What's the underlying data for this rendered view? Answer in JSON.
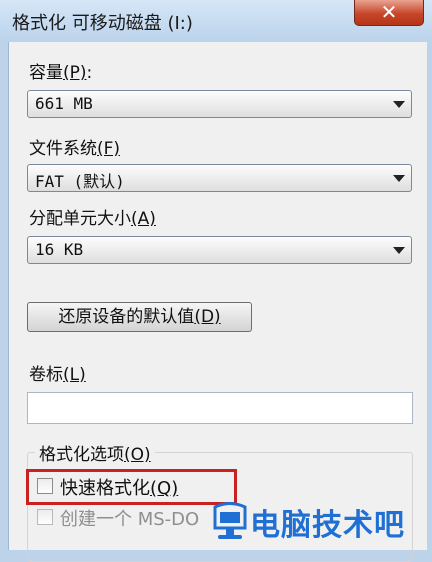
{
  "window": {
    "title": "格式化 可移动磁盘 (I:)",
    "close_glyph": "✕"
  },
  "capacity": {
    "label_prefix": "容量",
    "label_access": "(P)",
    "label_suffix": ":",
    "value": "661 MB"
  },
  "filesystem": {
    "label_prefix": "文件系统",
    "label_access": "(F)",
    "value": "FAT (默认)"
  },
  "allocation": {
    "label_prefix": "分配单元大小",
    "label_access": "(A)",
    "value": "16 KB"
  },
  "restore_defaults": {
    "label": "还原设备的默认值",
    "access": "(D)"
  },
  "volume_label": {
    "label_prefix": "卷标",
    "label_access": "(L)",
    "value": ""
  },
  "format_options": {
    "title": "格式化选项",
    "title_access": "(O)",
    "quick_format": {
      "label": "快速格式化",
      "access": "(Q)",
      "checked": false
    },
    "msdos_disk": {
      "label": "创建一个 MS-DO",
      "access": "",
      "checked": false,
      "disabled": true
    }
  },
  "highlight_color": "#c82121",
  "watermark": {
    "text": "电脑技术吧",
    "color": "#1f6fd4"
  }
}
